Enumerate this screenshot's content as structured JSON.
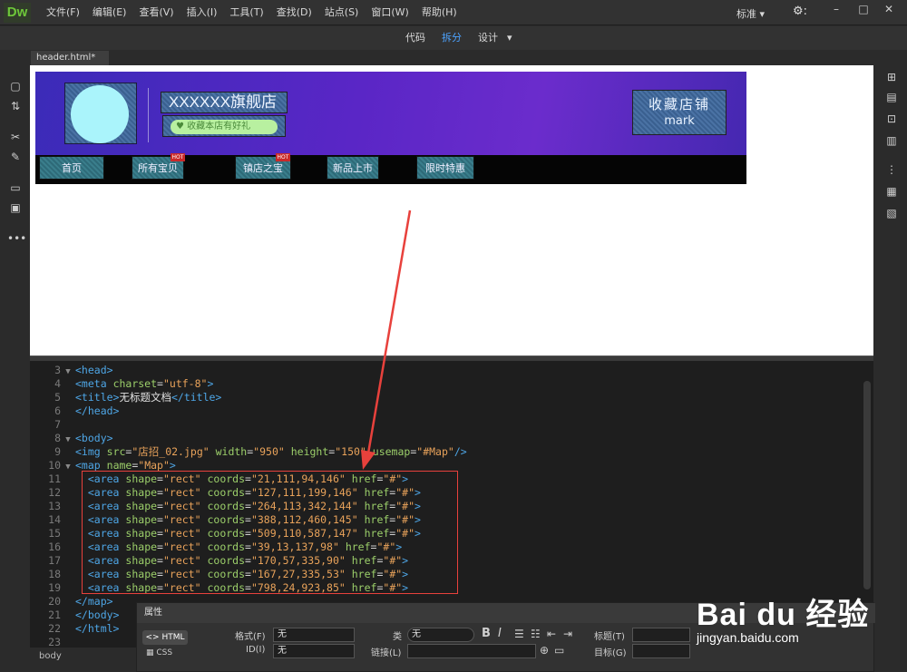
{
  "app": {
    "logo": "Dw"
  },
  "menu": [
    "文件(F)",
    "编辑(E)",
    "查看(V)",
    "插入(I)",
    "工具(T)",
    "查找(D)",
    "站点(S)",
    "窗口(W)",
    "帮助(H)"
  ],
  "workspace": {
    "label": "标准",
    "arrow": "▾"
  },
  "window_controls": {
    "minimize": "–",
    "maximize": "□",
    "close": "✕",
    "settings": "⚙:"
  },
  "views": {
    "code": "代码",
    "split": "拆分",
    "design": "设计",
    "more": "▾"
  },
  "document_tab": {
    "label": "header.html*",
    "close": "×"
  },
  "design_preview": {
    "shop_name": "XXXXXX旗舰店",
    "favorite_badge": "收藏本店有好礼",
    "collect_line1": "收藏店铺",
    "collect_line2": "mark",
    "nav": [
      "首页",
      "所有宝贝",
      "镇店之宝",
      "新品上市",
      "限时特惠"
    ],
    "hot_label": "HOT"
  },
  "code_lines": [
    {
      "n": "3",
      "fold": "▼",
      "html": "<span class=\"t\">&lt;head&gt;</span>"
    },
    {
      "n": "4",
      "fold": "",
      "html": "<span class=\"t\">&lt;meta</span> <span class=\"a\">charset</span>=<span class=\"v\">\"utf-8\"</span><span class=\"t\">&gt;</span>"
    },
    {
      "n": "5",
      "fold": "",
      "html": "<span class=\"t\">&lt;title&gt;</span><span class=\"tx\">无标题文档</span><span class=\"t\">&lt;/title&gt;</span>"
    },
    {
      "n": "6",
      "fold": "",
      "html": "<span class=\"t\">&lt;/head&gt;</span>"
    },
    {
      "n": "7",
      "fold": "",
      "html": ""
    },
    {
      "n": "8",
      "fold": "▼",
      "html": "<span class=\"t\">&lt;body&gt;</span>"
    },
    {
      "n": "9",
      "fold": "",
      "html": "<span class=\"t\">&lt;img</span> <span class=\"a\">src</span>=<span class=\"v\">\"店招_02.jpg\"</span> <span class=\"a\">width</span>=<span class=\"v\">\"950\"</span> <span class=\"a\">height</span>=<span class=\"v\">\"150\"</span> <span class=\"a\">usemap</span>=<span class=\"v\">\"#Map\"</span><span class=\"t\">/&gt;</span>"
    },
    {
      "n": "10",
      "fold": "▼",
      "html": "<span class=\"t\">&lt;map</span> <span class=\"a\">name</span>=<span class=\"v\">\"Map\"</span><span class=\"t\">&gt;</span>"
    },
    {
      "n": "11",
      "fold": "",
      "html": "  <span class=\"t\">&lt;area</span> <span class=\"a\">shape</span>=<span class=\"v\">\"rect\"</span> <span class=\"a\">coords</span>=<span class=\"v\">\"21,111,94,146\"</span> <span class=\"a\">href</span>=<span class=\"v\">\"#\"</span><span class=\"t\">&gt;</span>"
    },
    {
      "n": "12",
      "fold": "",
      "html": "  <span class=\"t\">&lt;area</span> <span class=\"a\">shape</span>=<span class=\"v\">\"rect\"</span> <span class=\"a\">coords</span>=<span class=\"v\">\"127,111,199,146\"</span> <span class=\"a\">href</span>=<span class=\"v\">\"#\"</span><span class=\"t\">&gt;</span>"
    },
    {
      "n": "13",
      "fold": "",
      "html": "  <span class=\"t\">&lt;area</span> <span class=\"a\">shape</span>=<span class=\"v\">\"rect\"</span> <span class=\"a\">coords</span>=<span class=\"v\">\"264,113,342,144\"</span> <span class=\"a\">href</span>=<span class=\"v\">\"#\"</span><span class=\"t\">&gt;</span>"
    },
    {
      "n": "14",
      "fold": "",
      "html": "  <span class=\"t\">&lt;area</span> <span class=\"a\">shape</span>=<span class=\"v\">\"rect\"</span> <span class=\"a\">coords</span>=<span class=\"v\">\"388,112,460,145\"</span> <span class=\"a\">href</span>=<span class=\"v\">\"#\"</span><span class=\"t\">&gt;</span>"
    },
    {
      "n": "15",
      "fold": "",
      "html": "  <span class=\"t\">&lt;area</span> <span class=\"a\">shape</span>=<span class=\"v\">\"rect\"</span> <span class=\"a\">coords</span>=<span class=\"v\">\"509,110,587,147\"</span> <span class=\"a\">href</span>=<span class=\"v\">\"#\"</span><span class=\"t\">&gt;</span>"
    },
    {
      "n": "16",
      "fold": "",
      "html": "  <span class=\"t\">&lt;area</span> <span class=\"a\">shape</span>=<span class=\"v\">\"rect\"</span> <span class=\"a\">coords</span>=<span class=\"v\">\"39,13,137,98\"</span> <span class=\"a\">href</span>=<span class=\"v\">\"#\"</span><span class=\"t\">&gt;</span>"
    },
    {
      "n": "17",
      "fold": "",
      "html": "  <span class=\"t\">&lt;area</span> <span class=\"a\">shape</span>=<span class=\"v\">\"rect\"</span> <span class=\"a\">coords</span>=<span class=\"v\">\"170,57,335,90\"</span> <span class=\"a\">href</span>=<span class=\"v\">\"#\"</span><span class=\"t\">&gt;</span>"
    },
    {
      "n": "18",
      "fold": "",
      "html": "  <span class=\"t\">&lt;area</span> <span class=\"a\">shape</span>=<span class=\"v\">\"rect\"</span> <span class=\"a\">coords</span>=<span class=\"v\">\"167,27,335,53\"</span> <span class=\"a\">href</span>=<span class=\"v\">\"#\"</span><span class=\"t\">&gt;</span>"
    },
    {
      "n": "19",
      "fold": "",
      "html": "  <span class=\"t\">&lt;area</span> <span class=\"a\">shape</span>=<span class=\"v\">\"rect\"</span> <span class=\"a\">coords</span>=<span class=\"v\">\"798,24,923,85\"</span> <span class=\"a\">href</span>=<span class=\"v\">\"#\"</span><span class=\"t\">&gt;</span>"
    },
    {
      "n": "20",
      "fold": "",
      "html": "<span class=\"t\">&lt;/map&gt;</span>"
    },
    {
      "n": "21",
      "fold": "",
      "html": "<span class=\"t\">&lt;/body&gt;</span>"
    },
    {
      "n": "22",
      "fold": "",
      "html": "<span class=\"t\">&lt;/html&gt;</span>"
    },
    {
      "n": "23",
      "fold": "",
      "html": ""
    }
  ],
  "status": {
    "tag": "body"
  },
  "properties": {
    "title": "属性",
    "html_btn": "HTML",
    "css_btn": "CSS",
    "format_label": "格式(F)",
    "format_value": "无",
    "id_label": "ID(I)",
    "id_value": "无",
    "class_label": "类",
    "class_value": "无",
    "link_label": "链接(L)",
    "title_label": "标题(T)",
    "target_label": "目标(G)"
  },
  "watermark": {
    "line1": "Bai du 经验",
    "line2": "jingyan.baidu.com"
  },
  "colors": {
    "accent": "#4da3ff",
    "annotation": "#e8413c"
  }
}
